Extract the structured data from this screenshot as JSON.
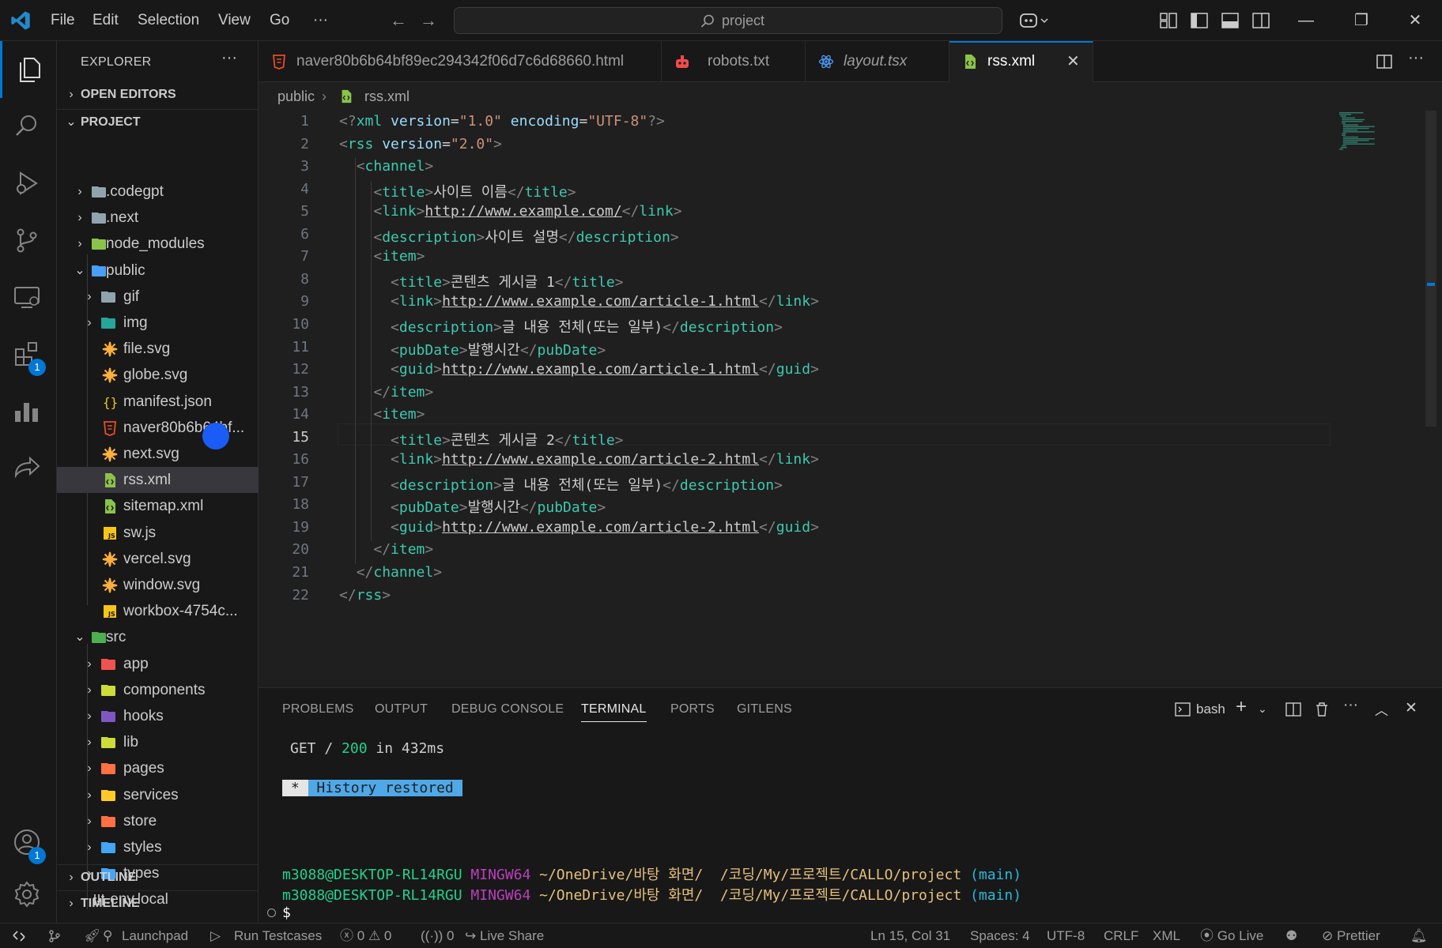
{
  "titlebar": {
    "menus": [
      "File",
      "Edit",
      "Selection",
      "View",
      "Go",
      "···"
    ],
    "search": "project"
  },
  "activity": {
    "extensions_badge": "1",
    "accounts_badge": "1"
  },
  "sidebar": {
    "title": "EXPLORER",
    "open_editors": "OPEN EDITORS",
    "project": "PROJECT",
    "outline": "OUTLINE",
    "timeline": "TIMELINE",
    "tree": [
      {
        "name": ".codegpt",
        "type": "folder",
        "level": 0,
        "chev": "›"
      },
      {
        "name": ".next",
        "type": "folder",
        "level": 0,
        "chev": "›"
      },
      {
        "name": "node_modules",
        "type": "folder",
        "level": 0,
        "chev": "›"
      },
      {
        "name": "public",
        "type": "folder",
        "level": 0,
        "chev": "⌄"
      },
      {
        "name": "gif",
        "type": "folder",
        "level": 1,
        "chev": "›"
      },
      {
        "name": "img",
        "type": "folder",
        "level": 1,
        "chev": "›"
      },
      {
        "name": "file.svg",
        "type": "svg",
        "level": 1
      },
      {
        "name": "globe.svg",
        "type": "svg",
        "level": 1
      },
      {
        "name": "manifest.json",
        "type": "json",
        "level": 1
      },
      {
        "name": "naver80b6b64bf...",
        "type": "html",
        "level": 1
      },
      {
        "name": "next.svg",
        "type": "svg",
        "level": 1
      },
      {
        "name": "rss.xml",
        "type": "xml",
        "level": 1,
        "selected": true
      },
      {
        "name": "sitemap.xml",
        "type": "xml",
        "level": 1
      },
      {
        "name": "sw.js",
        "type": "js",
        "level": 1
      },
      {
        "name": "vercel.svg",
        "type": "svg",
        "level": 1
      },
      {
        "name": "window.svg",
        "type": "svg",
        "level": 1
      },
      {
        "name": "workbox-4754c...",
        "type": "js",
        "level": 1
      },
      {
        "name": "src",
        "type": "folder",
        "level": 0,
        "chev": "⌄"
      },
      {
        "name": "app",
        "type": "folder",
        "level": 1,
        "chev": "›"
      },
      {
        "name": "components",
        "type": "folder",
        "level": 1,
        "chev": "›"
      },
      {
        "name": "hooks",
        "type": "folder",
        "level": 1,
        "chev": "›"
      },
      {
        "name": "lib",
        "type": "folder",
        "level": 1,
        "chev": "›"
      },
      {
        "name": "pages",
        "type": "folder",
        "level": 1,
        "chev": "›"
      },
      {
        "name": "services",
        "type": "folder",
        "level": 1,
        "chev": "›"
      },
      {
        "name": "store",
        "type": "folder",
        "level": 1,
        "chev": "›"
      },
      {
        "name": "styles",
        "type": "folder",
        "level": 1,
        "chev": "›"
      },
      {
        "name": "types",
        "type": "folder",
        "level": 1,
        "chev": "›"
      },
      {
        "name": ".env.local",
        "type": "env",
        "level": 0
      }
    ]
  },
  "tabs": [
    {
      "name": "naver80b6b64bf89ec294342f06d7c6d68660.html",
      "icon": "html-icon"
    },
    {
      "name": "robots.txt",
      "icon": "robot-icon"
    },
    {
      "name": "layout.tsx",
      "icon": "react-icon"
    },
    {
      "name": "rss.xml",
      "icon": "xml-icon",
      "active": true
    }
  ],
  "breadcrumb": [
    "public",
    "rss.xml"
  ],
  "editor": {
    "current_line": 15,
    "lines": [
      "<?xml version=\"1.0\" encoding=\"UTF-8\"?>",
      "<rss version=\"2.0\">",
      "  <channel>",
      "    <title>사이트 이름</title>",
      "    <link>http://www.example.com/</link>",
      "    <description>사이트 설명</description>",
      "    <item>",
      "      <title>콘텐츠 게시글 1</title>",
      "      <link>http://www.example.com/article-1.html</link>",
      "      <description>글 내용 전체(또는 일부)</description>",
      "      <pubDate>발행시간</pubDate>",
      "      <guid>http://www.example.com/article-1.html</guid>",
      "    </item>",
      "    <item>",
      "      <title>콘텐츠 게시글 2</title>",
      "      <link>http://www.example.com/article-2.html</link>",
      "      <description>글 내용 전체(또는 일부)</description>",
      "      <pubDate>발행시간</pubDate>",
      "      <guid>http://www.example.com/article-2.html</guid>",
      "    </item>",
      "  </channel>",
      "</rss>"
    ]
  },
  "panel": {
    "tabs": [
      "PROBLEMS",
      "OUTPUT",
      "DEBUG CONSOLE",
      "TERMINAL",
      "PORTS",
      "GITLENS"
    ],
    "active_tab": "TERMINAL",
    "shell": "bash",
    "terminal": {
      "get_method": "GET /",
      "get_status": "200",
      "get_rest": "in 432ms",
      "history_star": " * ",
      "history": " History restored ",
      "prompt_user": "m3088@DESKTOP-RL14RGU",
      "prompt_env": "MINGW64",
      "prompt_path": "~/OneDrive/바탕 화면/  /코딩/My/프로젝트/CALLO/project",
      "prompt_branch": "(main)",
      "dollar": "$"
    }
  },
  "statusbar": {
    "launchpad": "Launchpad",
    "run_testcases": "Run Testcases",
    "errors": "0",
    "warnings": "0",
    "ports": "0",
    "live_share": "Live Share",
    "position": "Ln 15, Col 31",
    "spaces": "Spaces: 4",
    "encoding": "UTF-8",
    "eol": "CRLF",
    "language": "XML",
    "go_live": "Go Live",
    "prettier": "Prettier"
  },
  "colors": {
    "accent": "#0078d4",
    "tag": "#3dc9b0",
    "attribute": "#9cdcfe",
    "string": "#ce9178",
    "terminal_user": "#23d18b",
    "terminal_env": "#bc3fbc",
    "terminal_path": "#e5c07b",
    "terminal_branch": "#29b8db"
  }
}
